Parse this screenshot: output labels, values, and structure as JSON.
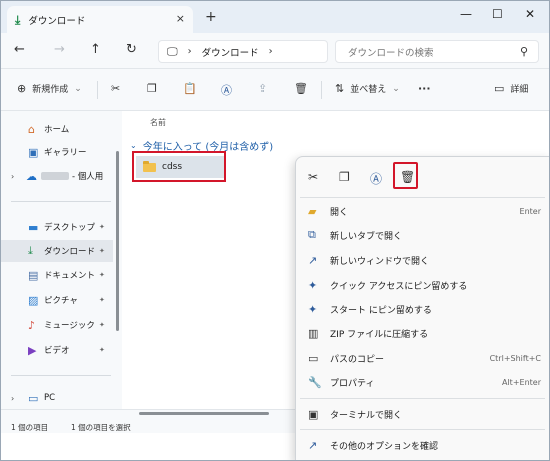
{
  "tab": {
    "title": "ダウンロード",
    "close_icon": "×",
    "new_tab_icon": "+"
  },
  "window_controls": {
    "minimize": "—",
    "maximize": "☐",
    "close": "✕"
  },
  "nav": {
    "back_icon": "←",
    "forward_icon": "→",
    "up_icon": "↑",
    "refresh_icon": "↻",
    "address_sep1": "›",
    "address_sep2": "›",
    "breadcrumb": "ダウンロード",
    "search_placeholder": "ダウンロードの検索"
  },
  "commandbar": {
    "new_label": "新規作成",
    "new_icon": "⊕",
    "new_dropdown": "⌄",
    "sort_label": "並べ替え",
    "sort_dropdown": "⌄",
    "more_icon": "···",
    "details_label": "詳細"
  },
  "sidebar": {
    "items": [
      {
        "label": "ホーム"
      },
      {
        "label": "ギャラリー"
      },
      {
        "label": "- 個人用"
      },
      {
        "label": "デスクトップ"
      },
      {
        "label": "ダウンロード"
      },
      {
        "label": "ドキュメント"
      },
      {
        "label": "ピクチャ"
      },
      {
        "label": "ミュージック"
      },
      {
        "label": "ビデオ"
      },
      {
        "label": "PC"
      }
    ],
    "pin_icon": "📌",
    "expand_icon": "›"
  },
  "main": {
    "column_header": "名前",
    "group_label": "今年に入って (今月は含めず)",
    "group_chevron": "⌄",
    "file_name": "cdss"
  },
  "status": {
    "item_count": "1 個の項目",
    "selected": "1 個の項目を選択"
  },
  "context_menu": {
    "items": [
      {
        "label": "開く",
        "shortcut": "Enter"
      },
      {
        "label": "新しいタブで開く",
        "shortcut": ""
      },
      {
        "label": "新しいウィンドウで開く",
        "shortcut": ""
      },
      {
        "label": "クイック アクセスにピン留めする",
        "shortcut": ""
      },
      {
        "label": "スタート にピン留めする",
        "shortcut": ""
      },
      {
        "label": "ZIP ファイルに圧縮する",
        "shortcut": ""
      },
      {
        "label": "パスのコピー",
        "shortcut": "Ctrl+Shift+C"
      },
      {
        "label": "プロパティ",
        "shortcut": "Alt+Enter"
      },
      {
        "label": "ターミナルで開く",
        "shortcut": ""
      },
      {
        "label": "その他のオプションを確認",
        "shortcut": ""
      }
    ]
  },
  "colors": {
    "highlight": "#d3162a",
    "accent": "#1f5fa8"
  }
}
